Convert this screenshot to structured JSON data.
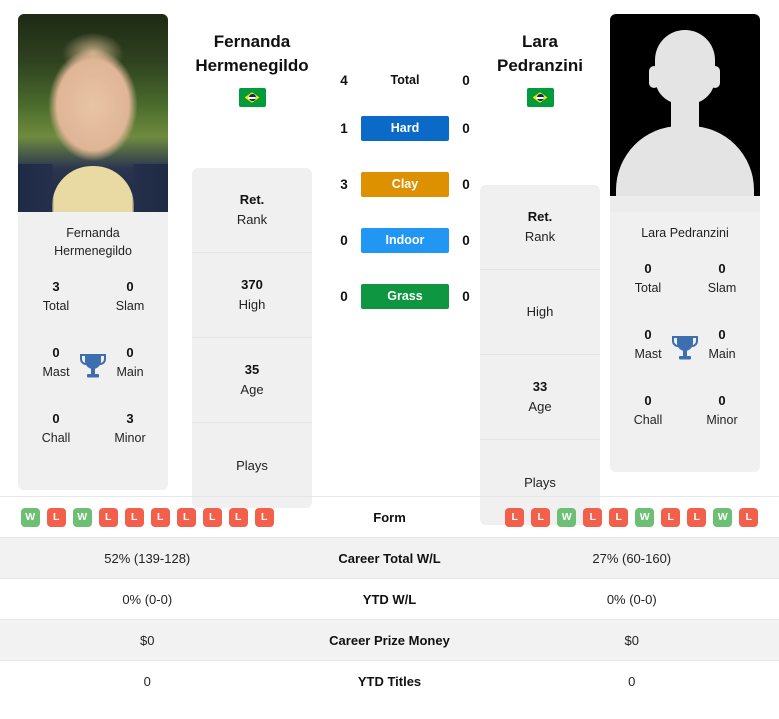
{
  "players": {
    "left": {
      "first_name": "Fernanda",
      "last_name": "Hermenegildo",
      "full_name": "Fernanda Hermenegildo",
      "photo_caption_line1": "Fernanda",
      "photo_caption_line2": "Hermenegildo",
      "country": "Brazil",
      "flag": "brazil-flag",
      "titles": {
        "total_value": "3",
        "total_label": "Total",
        "slam_value": "0",
        "slam_label": "Slam",
        "mast_value": "0",
        "mast_label": "Mast",
        "main_value": "0",
        "main_label": "Main",
        "chall_value": "0",
        "chall_label": "Chall",
        "minor_value": "3",
        "minor_label": "Minor"
      },
      "info": [
        {
          "value": "Ret.",
          "label": "Rank"
        },
        {
          "value": "370",
          "label": "High"
        },
        {
          "value": "35",
          "label": "Age"
        },
        {
          "value": "",
          "label": "Plays"
        }
      ],
      "form": [
        "W",
        "L",
        "W",
        "L",
        "L",
        "L",
        "L",
        "L",
        "L",
        "L"
      ],
      "career_total_wl": "52% (139-128)",
      "ytd_wl": "0% (0-0)",
      "career_prize_money": "$0",
      "ytd_titles": "0"
    },
    "right": {
      "first_name": "Lara",
      "last_name": "Pedranzini",
      "full_name": "Lara Pedranzini",
      "photo_caption_line1": "Lara Pedranzini",
      "photo_caption_line2": "",
      "country": "Brazil",
      "flag": "brazil-flag",
      "titles": {
        "total_value": "0",
        "total_label": "Total",
        "slam_value": "0",
        "slam_label": "Slam",
        "mast_value": "0",
        "mast_label": "Mast",
        "main_value": "0",
        "main_label": "Main",
        "chall_value": "0",
        "chall_label": "Chall",
        "minor_value": "0",
        "minor_label": "Minor"
      },
      "info": [
        {
          "value": "Ret.",
          "label": "Rank"
        },
        {
          "value": "",
          "label": "High"
        },
        {
          "value": "33",
          "label": "Age"
        },
        {
          "value": "",
          "label": "Plays"
        }
      ],
      "form": [
        "L",
        "L",
        "W",
        "L",
        "L",
        "W",
        "L",
        "L",
        "W",
        "L"
      ],
      "career_total_wl": "27% (60-160)",
      "ytd_wl": "0% (0-0)",
      "career_prize_money": "$0",
      "ytd_titles": "0"
    }
  },
  "head_to_head": [
    {
      "label": "Total",
      "left": "4",
      "right": "0",
      "color": "",
      "style": "plain"
    },
    {
      "label": "Hard",
      "left": "1",
      "right": "0",
      "color": "#0b69c7",
      "style": "chip"
    },
    {
      "label": "Clay",
      "left": "3",
      "right": "0",
      "color": "#dd9000",
      "style": "chip"
    },
    {
      "label": "Indoor",
      "left": "0",
      "right": "0",
      "color": "#2196f3",
      "style": "chip"
    },
    {
      "label": "Grass",
      "left": "0",
      "right": "0",
      "color": "#0f9640",
      "style": "chip"
    }
  ],
  "stats_table": [
    {
      "label": "Form",
      "key": "form",
      "type": "badges",
      "shade": false
    },
    {
      "label": "Career Total W/L",
      "key": "career_total_wl",
      "type": "text",
      "shade": true
    },
    {
      "label": "YTD W/L",
      "key": "ytd_wl",
      "type": "text",
      "shade": false
    },
    {
      "label": "Career Prize Money",
      "key": "career_prize_money",
      "type": "text",
      "shade": true
    },
    {
      "label": "YTD Titles",
      "key": "ytd_titles",
      "type": "text",
      "shade": false
    }
  ],
  "colors": {
    "hard": "#0b69c7",
    "clay": "#dd9000",
    "indoor": "#2196f3",
    "grass": "#0f9640",
    "win_badge": "#6cbf73",
    "loss_badge": "#f2604c",
    "trophy": "#3d6fb0",
    "card_bg": "#f0f0f0"
  }
}
